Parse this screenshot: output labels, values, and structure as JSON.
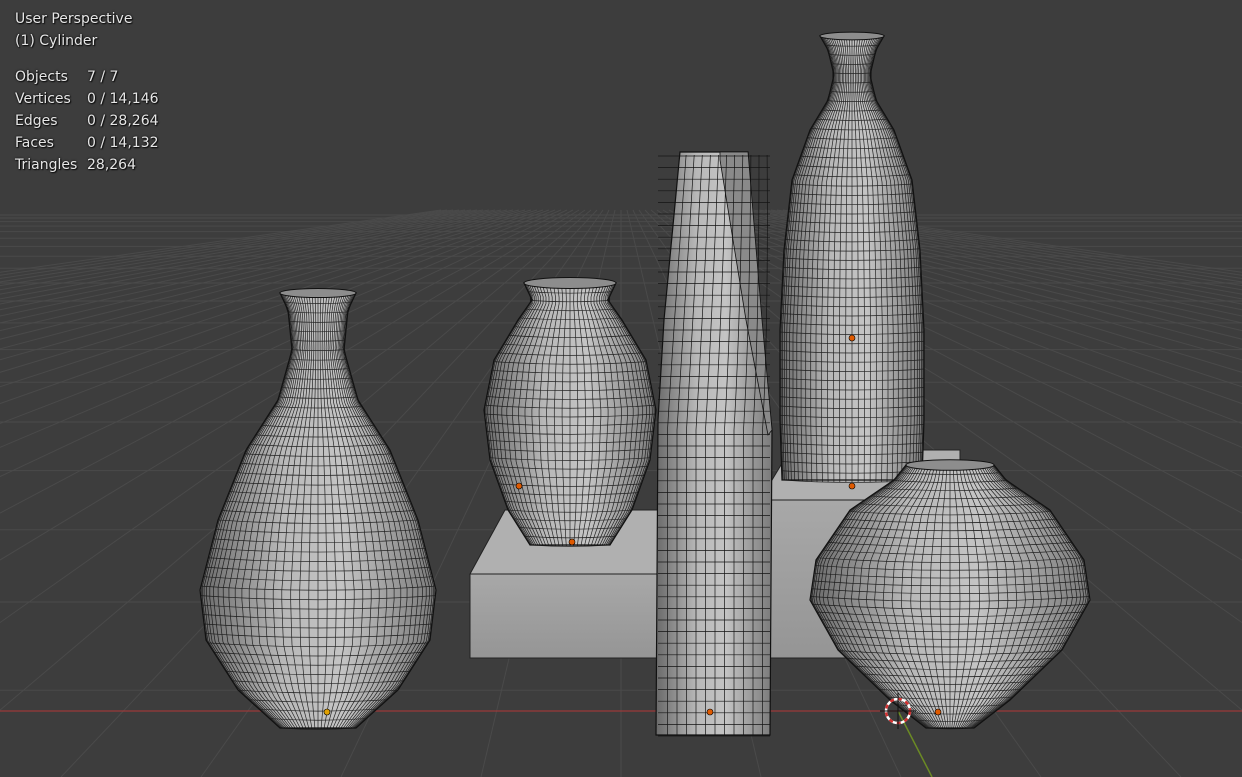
{
  "viewport": {
    "view_name": "User Perspective",
    "active_object": "(1) Cylinder",
    "stats": [
      {
        "label": "Objects",
        "value": "7 / 7"
      },
      {
        "label": "Vertices",
        "value": "0 / 14,146"
      },
      {
        "label": "Edges",
        "value": "0 / 28,264"
      },
      {
        "label": "Faces",
        "value": "0 / 14,132"
      },
      {
        "label": "Triangles",
        "value": "28,264"
      }
    ]
  },
  "colors": {
    "background": "#3d3d3d",
    "grid": "#4a4a4a",
    "x_axis": "#9a3a3a",
    "y_axis": "#6b8a24",
    "mesh_fill": "#a6a6a6",
    "wire": "#141414",
    "origin": "#e05a00",
    "cursor_red": "#d03030"
  }
}
